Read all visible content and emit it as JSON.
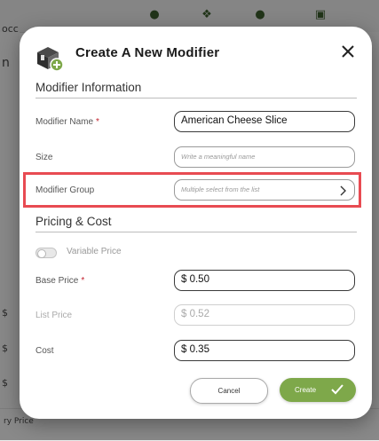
{
  "background": {
    "left_text": [
      "occ",
      "n",
      "$",
      "$",
      "$"
    ],
    "bottom_label": "ry Price"
  },
  "modal": {
    "title": "Create A New Modifier",
    "sections": {
      "info_title": "Modifier Information",
      "pricing_title": "Pricing & Cost"
    },
    "fields": {
      "modifier_name": {
        "label": "Modifier Name",
        "required": "*",
        "value": "American Cheese Slice"
      },
      "size": {
        "label": "Size",
        "placeholder": "Write a meaningful name"
      },
      "modifier_group": {
        "label": "Modifier Group",
        "placeholder": "Multiple select from the list"
      },
      "variable_price": {
        "label": "Variable Price",
        "enabled": false
      },
      "base_price": {
        "label": "Base Price",
        "required": "*",
        "value": "$ 0.50"
      },
      "list_price": {
        "label": "List Price",
        "value": "$ 0.52"
      },
      "cost": {
        "label": "Cost",
        "value": "$ 0.35"
      }
    },
    "buttons": {
      "cancel": "Cancel",
      "create": "Create"
    }
  },
  "colors": {
    "accent_green": "#7ea84a",
    "required_red": "#c2212d",
    "highlight_red": "#e84b52"
  },
  "icons": [
    "modifier-box-add-icon",
    "close-icon",
    "chevron-right-icon",
    "check-icon"
  ]
}
